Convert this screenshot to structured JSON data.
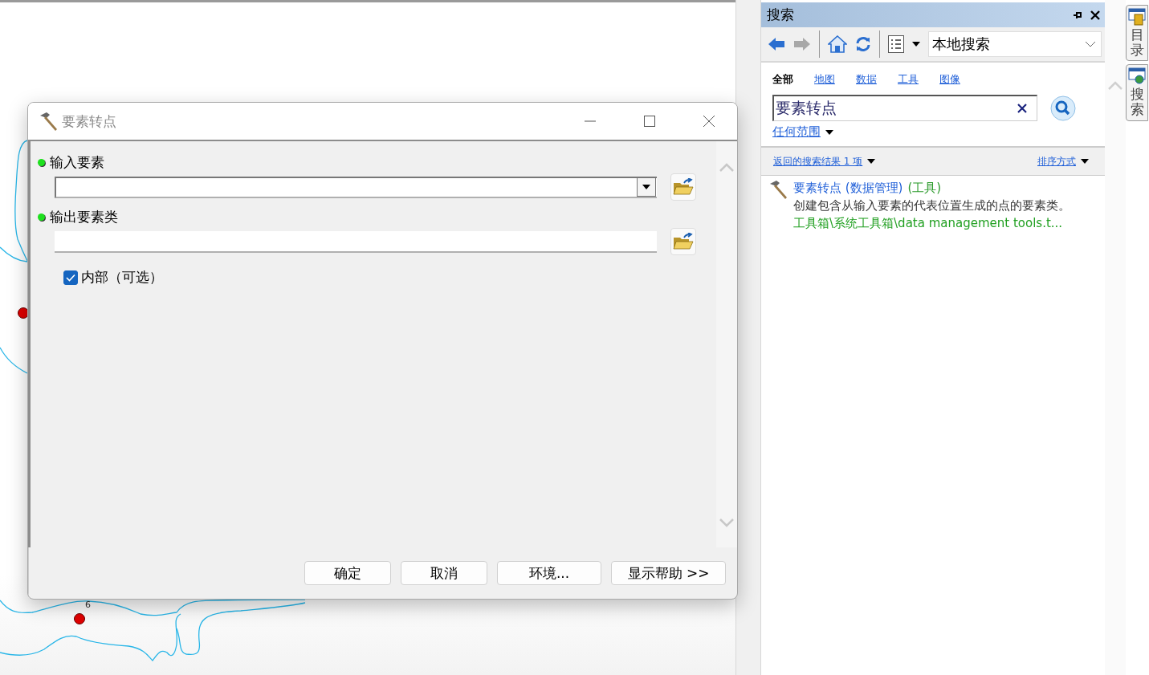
{
  "map": {
    "point_labels": [
      "6"
    ]
  },
  "dialog": {
    "title": "要素转点",
    "fields": [
      {
        "label": "输入要素",
        "kind": "dropdown"
      },
      {
        "label": "输出要素类",
        "kind": "text"
      }
    ],
    "checkbox": {
      "label": "内部（可选）",
      "checked": true
    },
    "buttons": [
      "确定",
      "取消",
      "环境...",
      "显示帮助 >>"
    ]
  },
  "search_panel": {
    "title": "搜索",
    "scope_select": {
      "value": "本地搜索"
    },
    "categories": [
      {
        "label": "全部",
        "selected": true
      },
      {
        "label": "地图",
        "selected": false
      },
      {
        "label": "数据",
        "selected": false
      },
      {
        "label": "工具",
        "selected": false
      },
      {
        "label": "图像",
        "selected": false
      }
    ],
    "search_field": {
      "value": "要素转点"
    },
    "range": "任何范围",
    "results_summary": "返回的搜索结果 1 项",
    "sort": "排序方式",
    "results": [
      {
        "title": "要素转点 (数据管理)",
        "type": "(工具)",
        "description": "创建包含从输入要素的代表位置生成的点的要素类。",
        "path": "工具箱\\系统工具箱\\data management tools.t..."
      }
    ]
  },
  "side_tabs": [
    {
      "label": "目录",
      "kind": "catalog"
    },
    {
      "label": "搜索",
      "kind": "search"
    }
  ]
}
